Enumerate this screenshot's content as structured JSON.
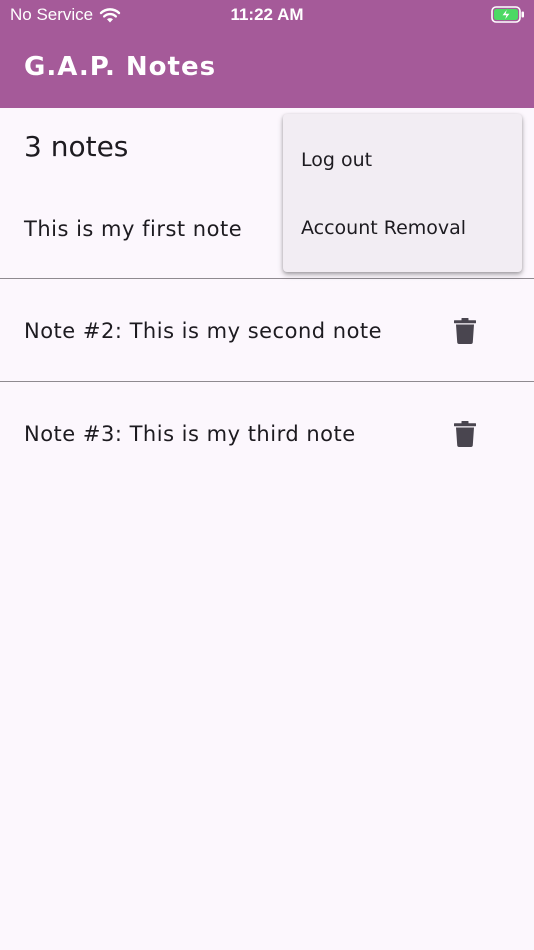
{
  "status_bar": {
    "carrier": "No Service",
    "time": "11:22 AM",
    "wifi_icon": "wifi-icon",
    "battery_icon": "battery-charging-icon"
  },
  "appbar": {
    "title": "G.A.P. Notes",
    "color": "#a55a99"
  },
  "notes": {
    "count_label": "3 notes",
    "items": [
      {
        "text": "This is my first note"
      },
      {
        "text": "Note #2: This is my second note"
      },
      {
        "text": "Note #3: This is my third note"
      }
    ],
    "delete_icon": "trash-icon"
  },
  "menu": {
    "items": [
      {
        "label": "Log out"
      },
      {
        "label": "Account Removal"
      }
    ]
  }
}
